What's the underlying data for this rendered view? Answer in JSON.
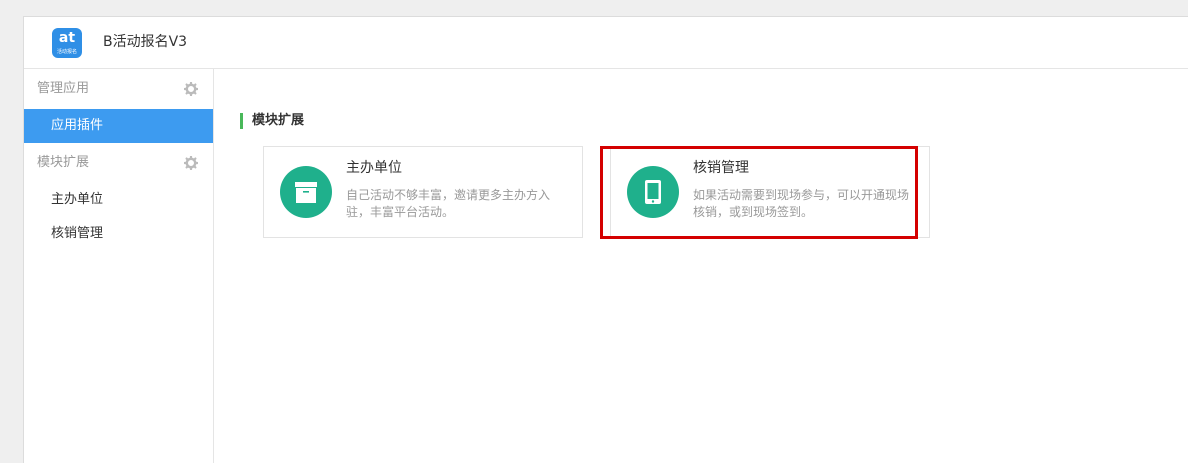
{
  "app": {
    "logo_big": "at",
    "logo_small": "活动报名",
    "title": "B活动报名V3"
  },
  "sidebar": {
    "sections": [
      {
        "label": "管理应用",
        "items": [
          {
            "label": "应用插件",
            "active": true
          }
        ]
      },
      {
        "label": "模块扩展",
        "items": [
          {
            "label": "主办单位"
          },
          {
            "label": "核销管理"
          }
        ]
      }
    ]
  },
  "main": {
    "section_title": "模块扩展",
    "cards": [
      {
        "title": "主办单位",
        "desc": "自己活动不够丰富，邀请更多主办方入驻，丰富平台活动。",
        "icon": "box-icon"
      },
      {
        "title": "核销管理",
        "desc": "如果活动需要到现场参与，可以开通现场核销，或到现场签到。",
        "icon": "tablet-icon"
      }
    ]
  },
  "colors": {
    "accent_blue": "#3d9bf0",
    "card_icon_green": "#1fb08c",
    "section_bar_green": "#49b85a",
    "highlight_red": "#d40000"
  }
}
